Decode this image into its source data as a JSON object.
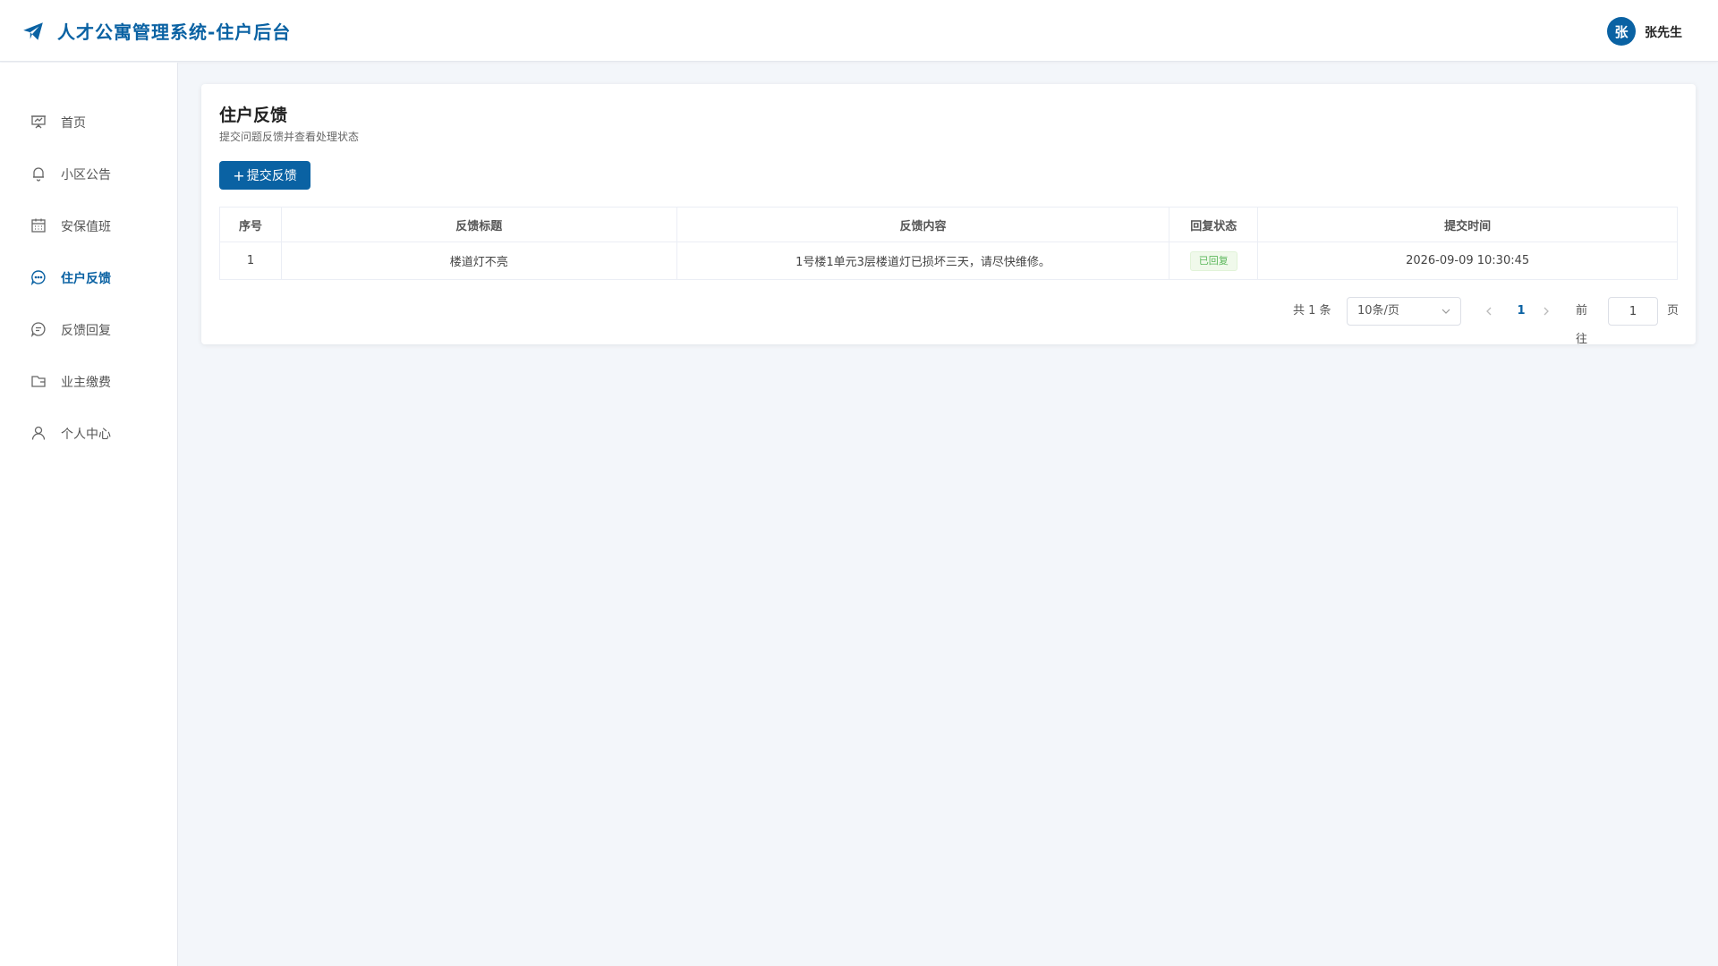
{
  "app": {
    "title": "人才公寓管理系统-住户后台",
    "brand_color": "#0a62a3"
  },
  "user": {
    "avatar_text": "张",
    "name": "张先生"
  },
  "sidebar": {
    "items": [
      {
        "label": "首页",
        "icon": "presentation-icon",
        "active": false
      },
      {
        "label": "小区公告",
        "icon": "bell-icon",
        "active": false
      },
      {
        "label": "安保值班",
        "icon": "calendar-icon",
        "active": false
      },
      {
        "label": "住户反馈",
        "icon": "chat-bubble-icon",
        "active": true
      },
      {
        "label": "反馈回复",
        "icon": "message-icon",
        "active": false
      },
      {
        "label": "业主缴费",
        "icon": "wallet-icon",
        "active": false
      },
      {
        "label": "个人中心",
        "icon": "user-icon",
        "active": false
      }
    ]
  },
  "main": {
    "title": "住户反馈",
    "subtitle": "提交问题反馈并查看处理状态",
    "submit_button": {
      "icon": "plus-icon",
      "label": "提交反馈"
    },
    "table": {
      "headers": [
        "序号",
        "反馈标题",
        "反馈内容",
        "回复状态",
        "提交时间"
      ],
      "rows": [
        {
          "index": "1",
          "title": "楼道灯不亮",
          "content": "1号楼1单元3层楼道灯已损坏三天，请尽快维修。",
          "status": "已回复",
          "status_color": "#5cb85c",
          "time": "2026-09-09 10:30:45"
        }
      ]
    },
    "pagination": {
      "total_text": "共 1 条",
      "page_size": "10条/页",
      "current_page": "1",
      "goto_label": "前往",
      "goto_value": "1",
      "goto_suffix": "页"
    }
  }
}
